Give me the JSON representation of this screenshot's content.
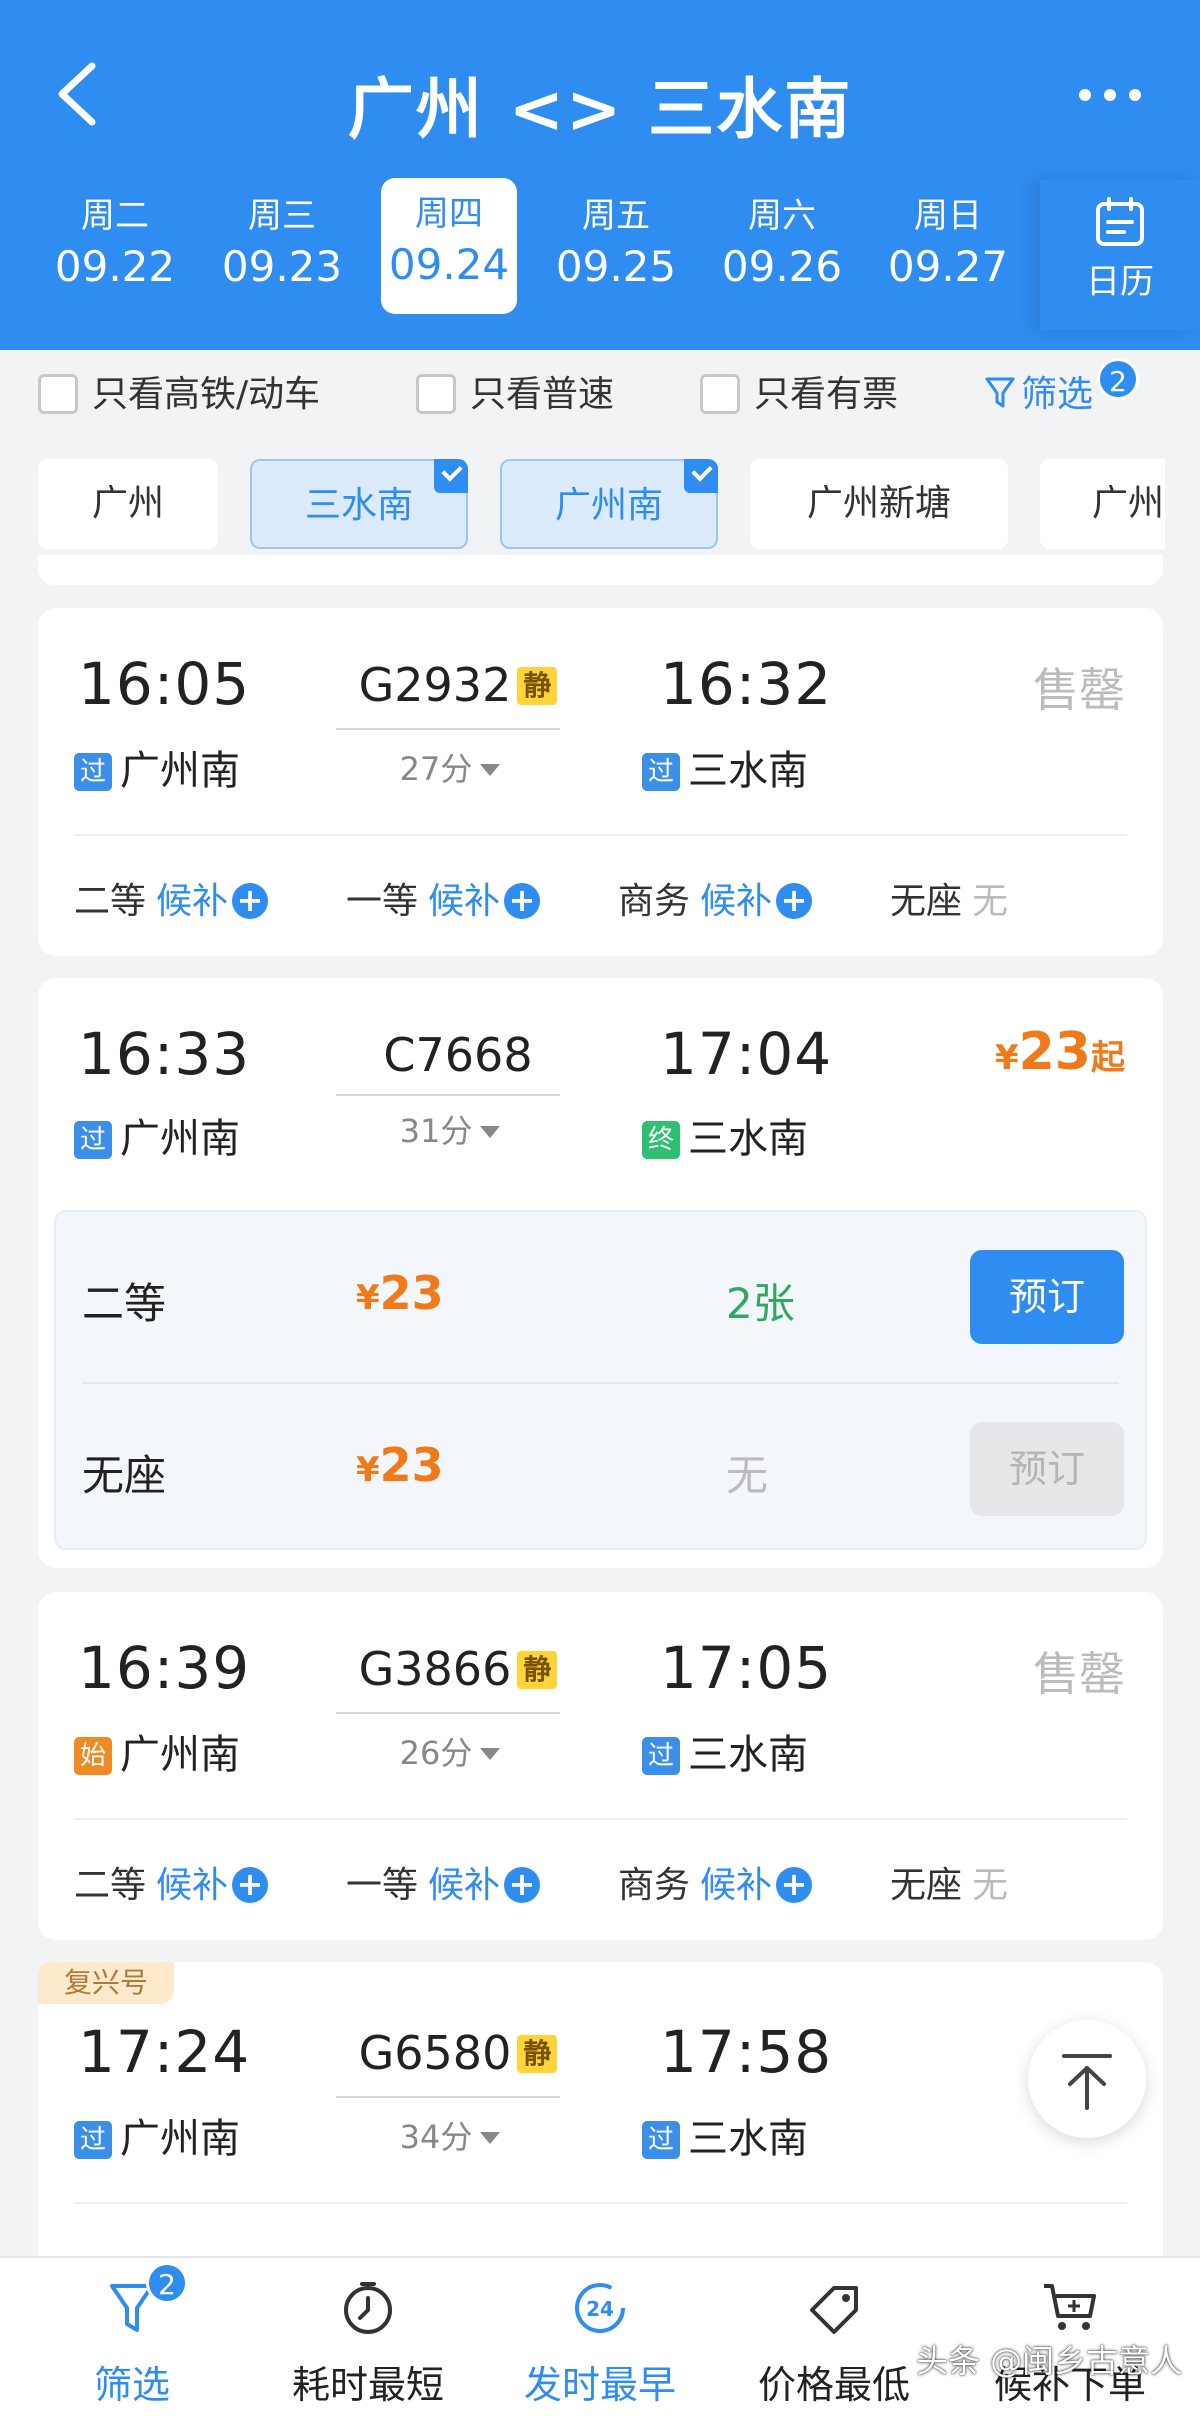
{
  "header": {
    "title": "广州 <> 三水南",
    "dates": [
      {
        "weekday": "周二",
        "date": "09.22",
        "active": false
      },
      {
        "weekday": "周三",
        "date": "09.23",
        "active": false
      },
      {
        "weekday": "周四",
        "date": "09.24",
        "active": true
      },
      {
        "weekday": "周五",
        "date": "09.25",
        "active": false
      },
      {
        "weekday": "周六",
        "date": "09.26",
        "active": false
      },
      {
        "weekday": "周日",
        "date": "09.27",
        "active": false
      }
    ],
    "calendar_label": "日历"
  },
  "filters": {
    "only_high_speed": "只看高铁/动车",
    "only_normal": "只看普速",
    "only_available": "只看有票",
    "screen_label": "筛选",
    "screen_count": "2"
  },
  "stations": [
    {
      "name": "广州",
      "selected": false
    },
    {
      "name": "三水南",
      "selected": true
    },
    {
      "name": "广州南",
      "selected": true
    },
    {
      "name": "广州新塘",
      "selected": false
    },
    {
      "name": "广州",
      "selected": false
    }
  ],
  "trains": [
    {
      "dep_time": "16:05",
      "train_no": "G2932",
      "quiet": "静",
      "arr_time": "16:32",
      "duration": "27分",
      "dep_tag": "过",
      "dep_station": "广州南",
      "arr_tag": "过",
      "arr_station": "三水南",
      "status": "售罄",
      "seats": [
        {
          "name": "二等",
          "value": "候补"
        },
        {
          "name": "一等",
          "value": "候补"
        },
        {
          "name": "商务",
          "value": "候补"
        },
        {
          "name": "无座",
          "value": "无"
        }
      ]
    },
    {
      "dep_time": "16:33",
      "train_no": "C7668",
      "arr_time": "17:04",
      "duration": "31分",
      "dep_tag": "过",
      "dep_station": "广州南",
      "arr_tag": "终",
      "arr_station": "三水南",
      "price_symbol": "¥",
      "price": "23",
      "price_suffix": "起",
      "seat_rows": [
        {
          "name": "二等",
          "symbol": "¥",
          "price": "23",
          "count": "2张",
          "button": "预订",
          "enabled": true
        },
        {
          "name": "无座",
          "symbol": "¥",
          "price": "23",
          "count": "无",
          "button": "预订",
          "enabled": false
        }
      ]
    },
    {
      "dep_time": "16:39",
      "train_no": "G3866",
      "quiet": "静",
      "arr_time": "17:05",
      "duration": "26分",
      "dep_tag": "始",
      "dep_station": "广州南",
      "arr_tag": "过",
      "arr_station": "三水南",
      "status": "售罄",
      "seats": [
        {
          "name": "二等",
          "value": "候补"
        },
        {
          "name": "一等",
          "value": "候补"
        },
        {
          "name": "商务",
          "value": "候补"
        },
        {
          "name": "无座",
          "value": "无"
        }
      ]
    },
    {
      "badge": "复兴号",
      "dep_time": "17:24",
      "train_no": "G6580",
      "quiet": "静",
      "arr_time": "17:58",
      "duration": "34分",
      "dep_tag": "过",
      "dep_station": "广州南",
      "arr_tag": "过",
      "arr_station": "三水南"
    }
  ],
  "bottom_bar": [
    {
      "label": "筛选",
      "icon": "filter-icon",
      "badge": "2",
      "active": true
    },
    {
      "label": "耗时最短",
      "icon": "timer-icon",
      "active": false
    },
    {
      "label": "发时最早",
      "icon": "clock-24-icon",
      "active": true
    },
    {
      "label": "价格最低",
      "icon": "price-tag-icon",
      "active": false
    },
    {
      "label": "候补下单",
      "icon": "cart-plus-icon",
      "active": false
    }
  ],
  "watermark": "头条 @闽乡古意人",
  "colors": {
    "primary": "#2f8cf0",
    "price": "#f07a1a",
    "available": "#2fa860",
    "quiet_badge": "#ffd43a"
  }
}
